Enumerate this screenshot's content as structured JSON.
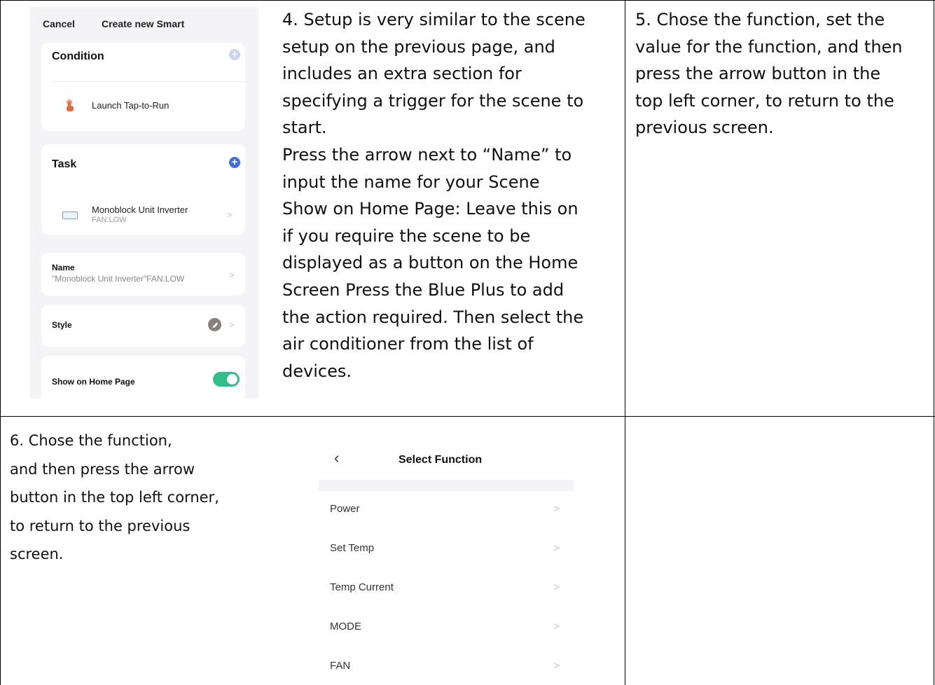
{
  "cell4": {
    "lines": [
      "4. Setup is very similar to the scene",
      "setup on the previous page, and",
      "includes an extra section for",
      "specifying a trigger for the scene to",
      "start.",
      "Press the arrow next to “Name” to",
      "input the name for your Scene",
      "Show on Home Page: Leave this on",
      "if you require the scene to be",
      "displayed as a button on the Home",
      "Screen Press the Blue Plus to add",
      "the action required. Then select the",
      "air conditioner from the list of",
      "devices."
    ]
  },
  "cell5": {
    "lines": [
      "5. Chose the function, set the",
      "value for the function, and then",
      "press the arrow button in the",
      "top left corner, to return to the",
      "previous screen."
    ]
  },
  "cell6": {
    "lines": [
      "6. Chose the function,",
      "and then press the arrow",
      "button in the top left corner,",
      "to return to the previous",
      "screen."
    ]
  },
  "screen1": {
    "cancel": "Cancel",
    "title": "Create new Smart",
    "condition_header": "Condition",
    "condition_item": "Launch Tap-to-Run",
    "task_header": "Task",
    "task_device": "Monoblock Unit Inverter",
    "task_value": "FAN:LOW",
    "name_label": "Name",
    "name_value": "\"Monoblock Unit Inverter\"FAN:LOW",
    "style_label": "Style",
    "show_home_label": "Show on Home Page",
    "show_home_on": true,
    "colors": {
      "accent": "#3d6fe6",
      "toggle": "#2fbf8a"
    }
  },
  "screen2": {
    "back_icon": "chevron-left-icon",
    "title": "Select Function",
    "items": [
      "Power",
      "Set Temp",
      "Temp Current",
      "MODE",
      "FAN"
    ]
  }
}
